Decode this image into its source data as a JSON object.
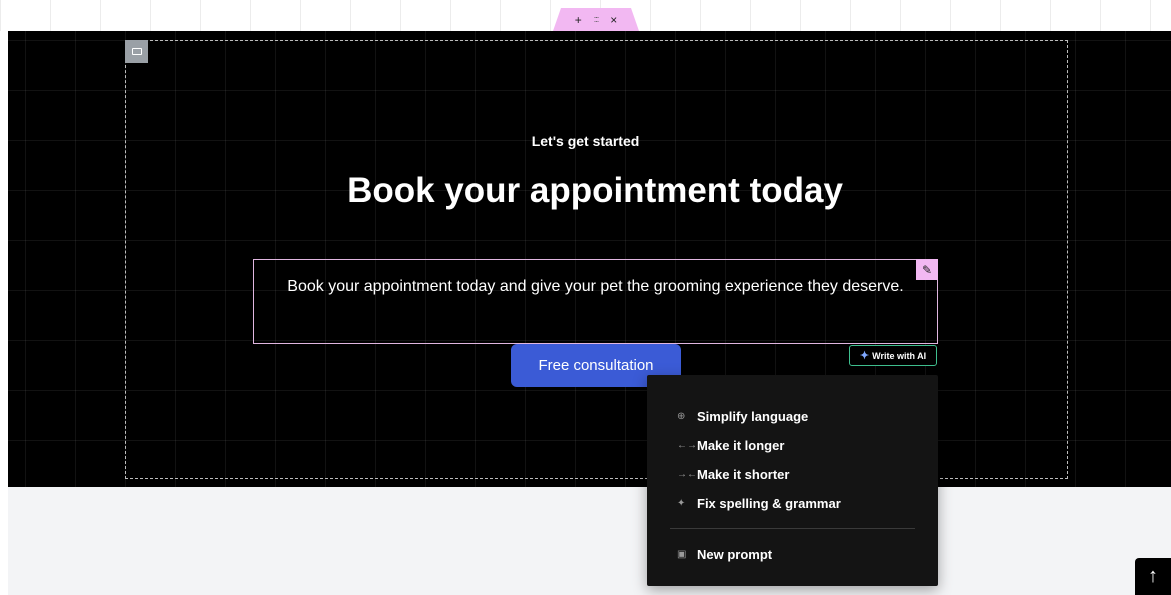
{
  "section_toolbar": {
    "add_icon": "+",
    "drag_icon": ":::",
    "close_icon": "×"
  },
  "hero": {
    "eyebrow": "Let's get started",
    "heading": "Book your appointment today",
    "subtext": "Book your appointment today and give your pet the grooming experience they deserve.",
    "cta_label": "Free consultation",
    "write_ai_label": "Write with AI"
  },
  "ai_menu": {
    "items": [
      {
        "label": "Simplify language",
        "icon": "globe-icon"
      },
      {
        "label": "Make it longer",
        "icon": "expand-arrows-icon"
      },
      {
        "label": "Make it shorter",
        "icon": "collapse-arrows-icon"
      },
      {
        "label": "Fix spelling & grammar",
        "icon": "sparkle-icon"
      }
    ],
    "prompt_label": "New prompt"
  },
  "colors": {
    "accent_pink": "#f2b8f2",
    "cta_blue": "#3b5bd6",
    "ai_border": "#3fbf8f"
  }
}
